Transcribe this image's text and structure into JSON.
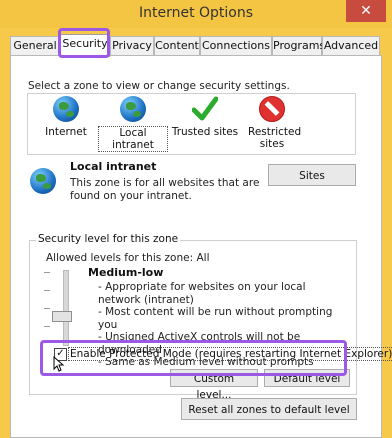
{
  "window": {
    "title": "Internet Options",
    "close_glyph": "✕"
  },
  "tabs": [
    {
      "label": "General"
    },
    {
      "label": "Security"
    },
    {
      "label": "Privacy"
    },
    {
      "label": "Content"
    },
    {
      "label": "Connections"
    },
    {
      "label": "Programs"
    },
    {
      "label": "Advanced"
    }
  ],
  "security": {
    "zone_hint": "Select a zone to view or change security settings.",
    "zones": [
      {
        "label": "Internet",
        "icon": "globe-icon"
      },
      {
        "label": "Local intranet",
        "icon": "intranet-globe-icon"
      },
      {
        "label": "Trusted sites",
        "icon": "checkmark-icon"
      },
      {
        "label": "Restricted sites",
        "icon": "restricted-icon"
      }
    ],
    "selected_zone_title": "Local intranet",
    "selected_zone_desc": "This zone is for all websites that are found on your intranet.",
    "sites_button": "Sites",
    "level_group_title": "Security level for this zone",
    "allowed_levels": "Allowed levels for this zone: All",
    "level_name": "Medium-low",
    "level_lines": [
      "- Appropriate for websites on your local network (intranet)",
      "- Most content will be run without prompting you",
      "- Unsigned ActiveX controls will not be downloaded",
      "- Same as Medium level without prompts"
    ],
    "protected_mode_label": "Enable Protected Mode (requires restarting Internet Explorer)",
    "protected_mode_checked": true,
    "custom_level_button": "Custom level...",
    "default_level_button": "Default level",
    "reset_all_button": "Reset all zones to default level"
  },
  "colors": {
    "title_bar": "#f4c542",
    "close_button": "#c74b3e",
    "highlight_outline": "#9b59e6"
  }
}
